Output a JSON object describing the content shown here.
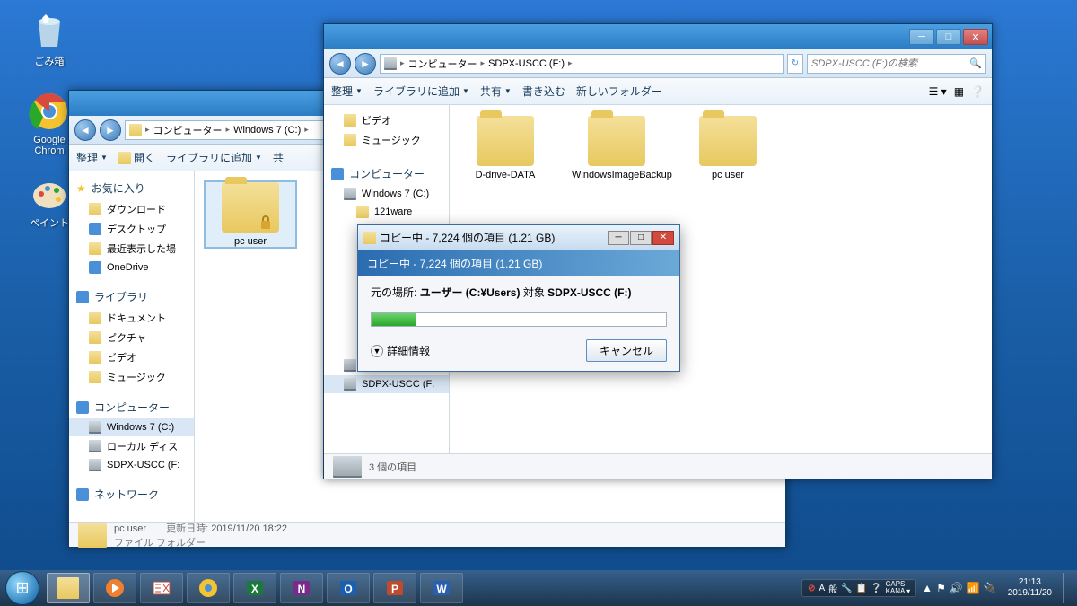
{
  "desktop": {
    "icons": [
      {
        "name": "recycle-bin",
        "label": "ごみ箱"
      },
      {
        "name": "google-chrome",
        "label": "Google Chrom"
      },
      {
        "name": "paint",
        "label": "ペイント"
      }
    ]
  },
  "window_back": {
    "breadcrumb": [
      "コンピューター",
      "Windows 7 (C:)"
    ],
    "toolbar": {
      "organize": "整理",
      "open": "開く",
      "library": "ライブラリに追加",
      "share": "共"
    },
    "sidebar": {
      "favorites": "お気に入り",
      "fav_items": [
        "ダウンロード",
        "デスクトップ",
        "最近表示した場",
        "OneDrive"
      ],
      "libraries": "ライブラリ",
      "lib_items": [
        "ドキュメント",
        "ピクチャ",
        "ビデオ",
        "ミュージック"
      ],
      "computer": "コンピューター",
      "comp_items": [
        "Windows 7 (C:)",
        "ローカル ディス",
        "SDPX-USCC (F:"
      ],
      "network": "ネットワーク"
    },
    "content": {
      "folder_label": "pc user"
    },
    "details": {
      "name": "pc user",
      "type": "ファイル フォルダー",
      "modified_label": "更新日時:",
      "modified_value": "2019/11/20 18:22"
    }
  },
  "window_front": {
    "breadcrumb": [
      "コンピューター",
      "SDPX-USCC (F:)"
    ],
    "search_placeholder": "SDPX-USCC (F:)の検索",
    "toolbar": {
      "organize": "整理",
      "library": "ライブラリに追加",
      "share": "共有",
      "burn": "書き込む",
      "new_folder": "新しいフォルダー"
    },
    "sidebar": {
      "lib_items": [
        "ビデオ",
        "ミュージック"
      ],
      "computer": "コンピューター",
      "comp_items": [
        "Windows 7 (C:)",
        "121ware",
        "ローカル ディス",
        "SDPX-USCC (F:"
      ]
    },
    "content": {
      "folders": [
        "D-drive-DATA",
        "WindowsImageBackup",
        "pc user"
      ]
    },
    "status": "3 個の項目"
  },
  "copy_dialog": {
    "title": "コピー中 - 7,224 個の項目 (1.21 GB)",
    "heading": "コピー中 - 7,224 個の項目 (1.21 GB)",
    "source_label": "元の場所:",
    "source_value": "ユーザー (C:¥Users)",
    "dest_label": "対象",
    "dest_value": "SDPX-USCC (F:)",
    "progress_pct": 15,
    "details_toggle": "詳細情報",
    "cancel": "キャンセル"
  },
  "taskbar": {
    "ime": {
      "a": "A",
      "han": "般",
      "caps": "CAPS",
      "kana": "KANA"
    },
    "time": "21:13",
    "date": "2019/11/20"
  }
}
